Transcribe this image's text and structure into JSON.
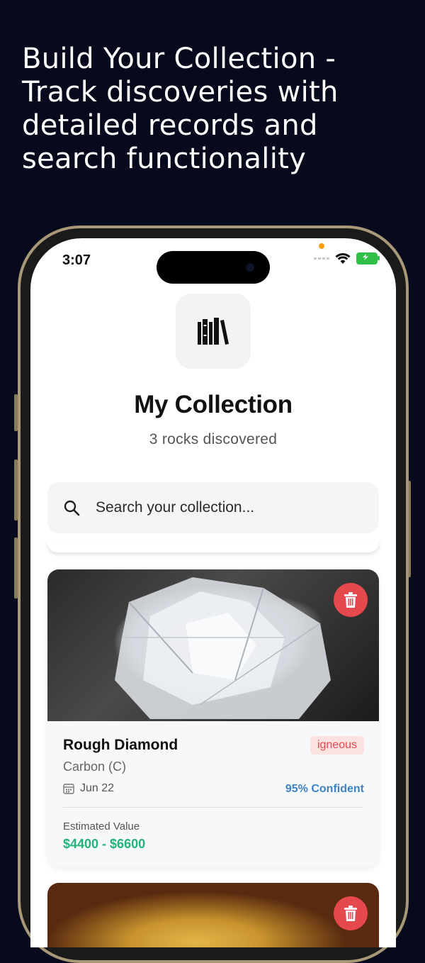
{
  "headline": "Build Your Collection - Track discoveries with detailed records and search functionality",
  "status_bar": {
    "time": "3:07"
  },
  "header": {
    "icon": "collection-books-icon",
    "title": "My Collection",
    "subtitle": "3 rocks discovered"
  },
  "search": {
    "placeholder": "Search your collection..."
  },
  "cards": [
    {
      "name": "Rough Diamond",
      "formula": "Carbon (C)",
      "type_badge": "igneous",
      "date": "Jun 22",
      "confidence": "95% Confident",
      "value_label": "Estimated Value",
      "value_range": "$4400 - $6600"
    }
  ],
  "colors": {
    "background": "#070a1c",
    "delete": "#e5484d",
    "confidence": "#3f82c4",
    "value": "#23b27a",
    "badge_bg": "#fde2e2"
  }
}
